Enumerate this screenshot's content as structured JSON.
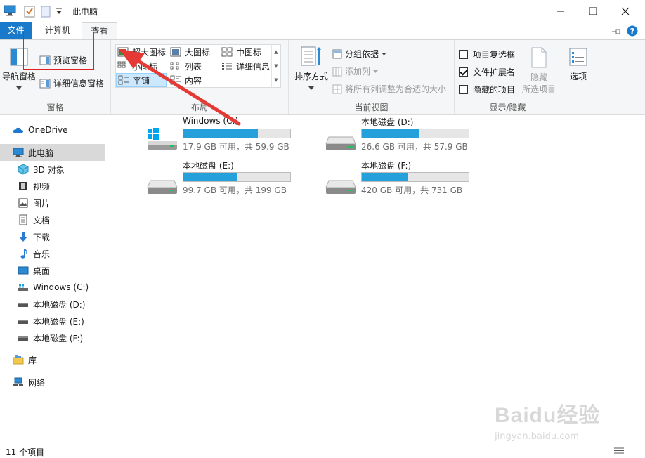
{
  "window": {
    "title": "此电脑",
    "controls": {
      "minimize": "minimize",
      "maximize": "maximize",
      "close": "close"
    }
  },
  "tabs": {
    "file": "文件",
    "computer": "计算机",
    "view": "查看"
  },
  "ribbon": {
    "panes": {
      "label": "窗格",
      "nav_pane": "导航窗格",
      "preview_pane": "预览窗格",
      "details_pane": "详细信息窗格"
    },
    "layout": {
      "label": "布局",
      "extra_large": "超大图标",
      "large": "大图标",
      "medium": "中图标",
      "small": "小图标",
      "list": "列表",
      "details": "详细信息",
      "tiles": "平铺",
      "content": "内容"
    },
    "current_view": {
      "label": "当前视图",
      "sort_by": "排序方式",
      "group_by": "分组依据",
      "add_columns": "添加列",
      "size_columns": "将所有列调整为合适的大小"
    },
    "show_hide": {
      "label": "显示/隐藏",
      "item_checkboxes": "项目复选框",
      "item_checkboxes_checked": false,
      "file_extensions": "文件扩展名",
      "file_extensions_checked": true,
      "hidden_items": "隐藏的项目",
      "hidden_items_checked": false,
      "hide_selected": "隐藏",
      "hide_selected_sub": "所选项目"
    },
    "options": "选项"
  },
  "nav": {
    "onedrive": "OneDrive",
    "this_pc": "此电脑",
    "objects3d": "3D 对象",
    "videos": "视频",
    "pictures": "图片",
    "documents": "文档",
    "downloads": "下载",
    "music": "音乐",
    "desktop": "桌面",
    "drive_c": "Windows (C:)",
    "drive_d": "本地磁盘 (D:)",
    "drive_e": "本地磁盘 (E:)",
    "drive_f": "本地磁盘 (F:)",
    "libraries": "库",
    "network": "网络"
  },
  "drives": [
    {
      "name": "Windows (C:)",
      "free": "17.9 GB 可用，共 59.9 GB",
      "used_fraction": 0.7
    },
    {
      "name": "本地磁盘 (D:)",
      "free": "26.6 GB 可用，共 57.9 GB",
      "used_fraction": 0.54
    },
    {
      "name": "本地磁盘 (E:)",
      "free": "99.7 GB 可用，共 199 GB",
      "used_fraction": 0.5
    },
    {
      "name": "本地磁盘 (F:)",
      "free": "420 GB 可用，共 731 GB",
      "used_fraction": 0.43
    }
  ],
  "status": {
    "item_count": "11 个项目"
  },
  "watermark": {
    "text": "Baidu经验",
    "url": "jingyan.baidu.com"
  },
  "colors": {
    "accent": "#1979ca",
    "drive_fill": "#26a0da",
    "annotation": "#e02020"
  }
}
